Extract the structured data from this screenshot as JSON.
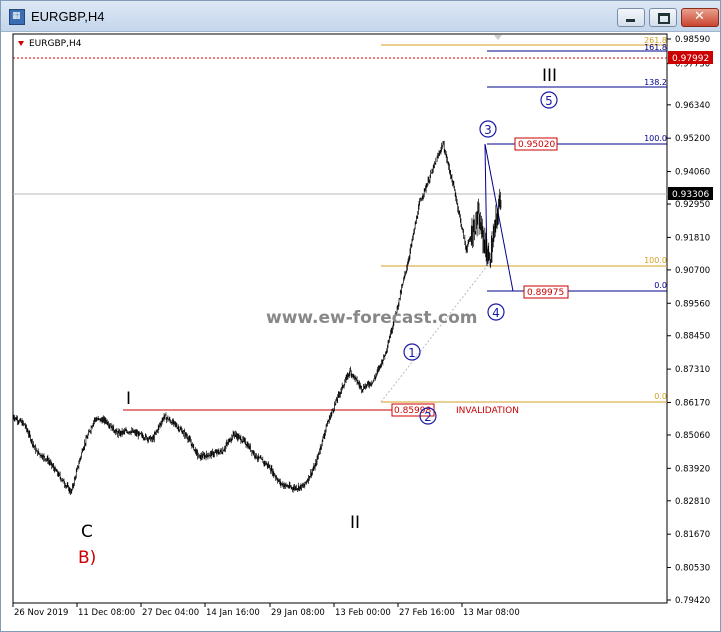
{
  "window": {
    "title": "EURGBP,H4",
    "app_icon": "mt4-chart-icon",
    "minimize_icon": "minimize-icon",
    "maximize_icon": "maximize-icon",
    "close_icon": "close-icon"
  },
  "chart_label": "EURGBP,H4",
  "watermark": "www.ew-forecast.com",
  "chart_data": {
    "type": "candlestick",
    "symbol": "EURGBP",
    "timeframe": "H4",
    "ylim": [
      0.7945,
      0.9875
    ],
    "y_ticks": [
      "0.98590",
      "0.97750",
      "0.96340",
      "0.95200",
      "0.94060",
      "0.92950",
      "0.91810",
      "0.90700",
      "0.89560",
      "0.88450",
      "0.87310",
      "0.86170",
      "0.85060",
      "0.83920",
      "0.82810",
      "0.81670",
      "0.80530",
      "0.79420"
    ],
    "x_ticks": [
      "26 Nov 2019",
      "11 Dec 08:00",
      "27 Dec 04:00",
      "14 Jan 16:00",
      "29 Jan 08:00",
      "13 Feb 00:00",
      "27 Feb 16:00",
      "13 Mar 08:00"
    ],
    "current_price": "0.93306",
    "top_price_label": "0.97992",
    "price_path": [
      {
        "x": "26 Nov 2019",
        "y": 0.857
      },
      {
        "x": "1 Dec",
        "y": 0.854
      },
      {
        "x": "5 Dec",
        "y": 0.845
      },
      {
        "x": "8 Dec",
        "y": 0.842
      },
      {
        "x": "10 Dec",
        "y": 0.8365
      },
      {
        "x": "11 Dec 08:00",
        "y": 0.831
      },
      {
        "x": "13 Dec",
        "y": 0.846
      },
      {
        "x": "16 Dec",
        "y": 0.856
      },
      {
        "x": "20 Dec",
        "y": 0.8555
      },
      {
        "x": "24 Dec",
        "y": 0.851
      },
      {
        "x": "27 Dec 04:00",
        "y": 0.852
      },
      {
        "x": "2 Jan",
        "y": 0.8505
      },
      {
        "x": "8 Jan",
        "y": 0.849
      },
      {
        "x": "12 Jan",
        "y": 0.857
      },
      {
        "x": "14 Jan 16:00",
        "y": 0.854
      },
      {
        "x": "18 Jan",
        "y": 0.85
      },
      {
        "x": "22 Jan",
        "y": 0.843
      },
      {
        "x": "26 Jan",
        "y": 0.844
      },
      {
        "x": "29 Jan 08:00",
        "y": 0.845
      },
      {
        "x": "2 Feb",
        "y": 0.851
      },
      {
        "x": "6 Feb",
        "y": 0.848
      },
      {
        "x": "9 Feb",
        "y": 0.843
      },
      {
        "x": "11 Feb",
        "y": 0.84
      },
      {
        "x": "13 Feb 00:00",
        "y": 0.834
      },
      {
        "x": "17 Feb",
        "y": 0.8325
      },
      {
        "x": "20 Feb",
        "y": 0.833
      },
      {
        "x": "23 Feb",
        "y": 0.84
      },
      {
        "x": "26 Feb",
        "y": 0.854
      },
      {
        "x": "28 Feb",
        "y": 0.864
      },
      {
        "x": "2 Mar",
        "y": 0.8725
      },
      {
        "x": "4 Mar",
        "y": 0.8665
      },
      {
        "x": "7 Mar",
        "y": 0.869
      },
      {
        "x": "10 Mar",
        "y": 0.878
      },
      {
        "x": "12 Mar",
        "y": 0.893
      },
      {
        "x": "14 Mar",
        "y": 0.91
      },
      {
        "x": "16 Mar",
        "y": 0.93
      },
      {
        "x": "17 Mar",
        "y": 0.94
      },
      {
        "x": "18 Mar",
        "y": 0.9502
      },
      {
        "x": "19 Mar",
        "y": 0.934
      },
      {
        "x": "20 Mar",
        "y": 0.914
      },
      {
        "x": "21 Mar",
        "y": 0.925
      },
      {
        "x": "22 Mar",
        "y": 0.91
      },
      {
        "x": "23 Mar",
        "y": 0.9331
      }
    ],
    "horizontal_levels": [
      {
        "price": 0.862,
        "color": "#cc0000",
        "label": "I"
      },
      {
        "price": 0.9502,
        "color": "#00008b",
        "label": "100.0"
      },
      {
        "price": 0.8997,
        "color": "#00008b",
        "label": "0.0"
      },
      {
        "price": 0.9762,
        "color": "#00008b",
        "label": "138.2"
      },
      {
        "price": 0.982,
        "color": "#00008b",
        "label": "161.8"
      },
      {
        "price": 0.9072,
        "color": "#d4a020",
        "label": "100.0"
      },
      {
        "price": 0.863,
        "color": "#d4a020",
        "label": "0.0"
      },
      {
        "price": 0.985,
        "color": "#d4a020",
        "label": "261.8"
      },
      {
        "price": 0.9799,
        "color": "#cc0000",
        "label": "0.97992"
      }
    ]
  },
  "fib_labels": {
    "l2618": "261.8",
    "l1618": "161.8",
    "l1382": "138.2",
    "l100a": "100.0",
    "l100b": "100.0",
    "l0a": "0.0",
    "l0b": "0.0"
  },
  "price_boxes": {
    "high": "0.95020",
    "low": "0.89975",
    "invalidation_price": "0.85998"
  },
  "invalidation_text": "INVALIDATION",
  "wave_labels": {
    "w1_primary": "I",
    "w2_primary": "II",
    "w3_primary": "III",
    "c_label": "C",
    "b_label": "B)",
    "circ1": "1",
    "circ2": "2",
    "circ3": "3",
    "circ4": "4",
    "circ5": "5"
  }
}
